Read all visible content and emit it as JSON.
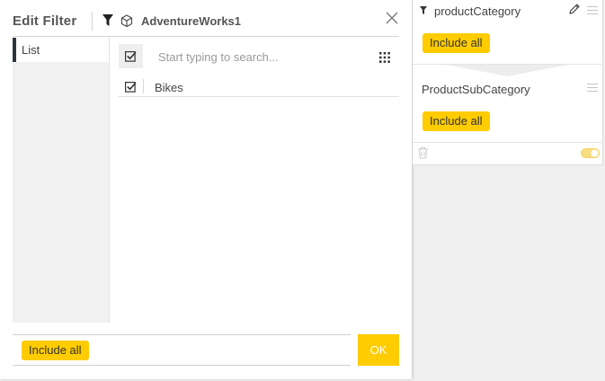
{
  "dialog": {
    "title": "Edit Filter",
    "datasource": "AdventureWorks1",
    "tabs": [
      {
        "label": "List",
        "active": true
      }
    ],
    "search": {
      "placeholder": "Start typing to search...",
      "value": ""
    },
    "items": [
      {
        "label": "Bikes",
        "checked": true
      }
    ],
    "footer_value": "Include all",
    "ok_label": "OK"
  },
  "filter_panel": {
    "filters": [
      {
        "title": "productCategory",
        "value": "Include all"
      },
      {
        "title": "ProductSubCategory",
        "value": "Include all"
      }
    ]
  },
  "colors": {
    "accent": "#ffcc00",
    "active_tab_marker": "#2e3440",
    "panel_background": "#f0f0f0"
  },
  "icons": {
    "filter": "funnel-icon",
    "datasource": "cube-icon",
    "close": "close-icon",
    "select_all": "checkbox-checked-icon",
    "view_options": "grid-dots-icon",
    "edit": "pencil-icon",
    "drag": "drag-handle-icon",
    "delete": "trash-icon",
    "toggle": "toggle-switch-icon"
  }
}
